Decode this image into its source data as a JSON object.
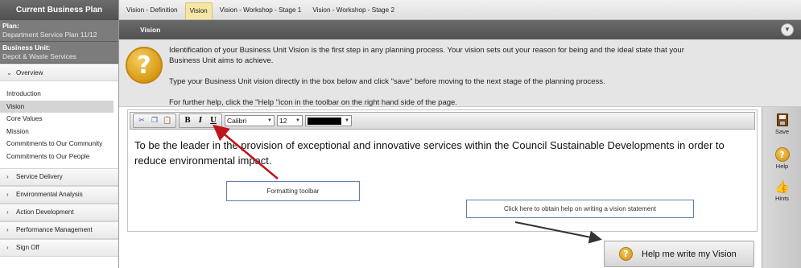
{
  "sidebar": {
    "header": "Current Business Plan",
    "plan_label": "Plan:",
    "plan_value": "Department Service Plan 11/12",
    "unit_label": "Business Unit:",
    "unit_value": "Depot & Waste Services",
    "sections": [
      {
        "label": "Overview",
        "expanded": true,
        "chevron": "chevron-down-icon"
      },
      {
        "label": "Service Delivery",
        "expanded": false,
        "chevron": "chevron-right-icon"
      },
      {
        "label": "Environmental Analysis",
        "expanded": false,
        "chevron": "chevron-right-icon"
      },
      {
        "label": "Action Development",
        "expanded": false,
        "chevron": "chevron-right-icon"
      },
      {
        "label": "Performance Management",
        "expanded": false,
        "chevron": "chevron-right-icon"
      },
      {
        "label": "Sign Off",
        "expanded": false,
        "chevron": "chevron-right-icon"
      }
    ],
    "overview_items": [
      {
        "label": "Introduction",
        "active": false
      },
      {
        "label": "Vision",
        "active": true
      },
      {
        "label": "Core Values",
        "active": false
      },
      {
        "label": "Mission",
        "active": false
      },
      {
        "label": "Commitments to Our Community",
        "active": false
      },
      {
        "label": "Commitments to Our People",
        "active": false
      }
    ]
  },
  "tabs": [
    {
      "label": "Vision - Definition",
      "active": false
    },
    {
      "label": "Vision",
      "active": true
    },
    {
      "label": "Vision - Workshop - Stage 1",
      "active": false
    },
    {
      "label": "Vision - Workshop - Stage 2",
      "active": false
    }
  ],
  "section_title": "Vision",
  "intro": {
    "icon": "question-icon",
    "line1": "Identification of your Business Unit Vision is the first step in any planning process.  Your vision sets out your reason for being and the ideal state that your",
    "line2": "Business Unit aims to achieve.",
    "line3": "Type your Business Unit vision directly in the box below and click \"save\" before moving to the next stage of the planning process.",
    "line4": "For further help, click the \"Help \"icon in the toolbar on the right hand side of the page."
  },
  "toolbar": {
    "font_family": "Calibri",
    "font_size": "12",
    "text_color": "#000000",
    "bold": "B",
    "italic": "I",
    "underline": "U"
  },
  "editor": {
    "text": "To be the leader in the provision of exceptional and innovative services within the Council Sustainable Developments in order to reduce environmental impact."
  },
  "callouts": {
    "toolbar": "Formatting toolbar",
    "help": "Click here to obtain help on writing a vision statement"
  },
  "help_button": {
    "label": "Help me write my Vision"
  },
  "right_toolbar": {
    "save": "Save",
    "help": "Help",
    "hints": "Hints"
  },
  "colors": {
    "active_tab": "#f6e6a6",
    "title_bar": "#5e5e5e",
    "arrow": "#c0141c",
    "callout_border": "#5a7fb0"
  }
}
